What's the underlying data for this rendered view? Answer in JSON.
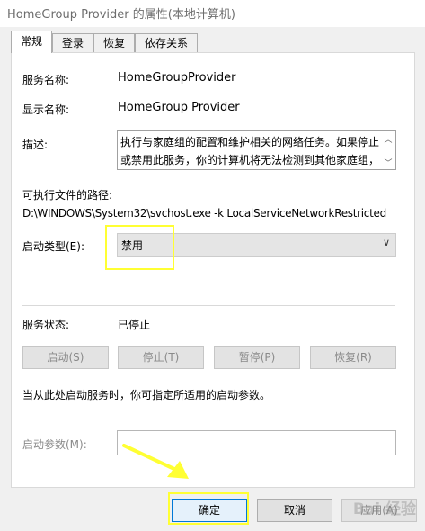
{
  "window": {
    "title": "HomeGroup Provider 的属性(本地计算机)"
  },
  "tabs": [
    {
      "label": "常规"
    },
    {
      "label": "登录"
    },
    {
      "label": "恢复"
    },
    {
      "label": "依存关系"
    }
  ],
  "general": {
    "service_name_label": "服务名称:",
    "service_name_value": "HomeGroupProvider",
    "display_name_label": "显示名称:",
    "display_name_value": "HomeGroup Provider",
    "description_label": "描述:",
    "description_value": "执行与家庭组的配置和维护相关的网络任务。如果停止或禁用此服务，你的计算机将无法检测到其他家庭组，",
    "exe_path_label": "可执行文件的路径:",
    "exe_path_value": "D:\\WINDOWS\\System32\\svchost.exe -k LocalServiceNetworkRestricted",
    "startup_type_label": "启动类型(E):",
    "startup_type_value": "禁用",
    "service_status_label": "服务状态:",
    "service_status_value": "已停止",
    "hint_text": "当从此处启动服务时，你可指定所适用的启动参数。",
    "start_params_label": "启动参数(M):"
  },
  "service_buttons": {
    "start": "启动(S)",
    "stop": "停止(T)",
    "pause": "暂停(P)",
    "resume": "恢复(R)"
  },
  "dialog_buttons": {
    "ok": "确定",
    "cancel": "取消",
    "apply": "应用(A)"
  },
  "watermark": "Bai 经验",
  "highlight_color": "#ffff33"
}
